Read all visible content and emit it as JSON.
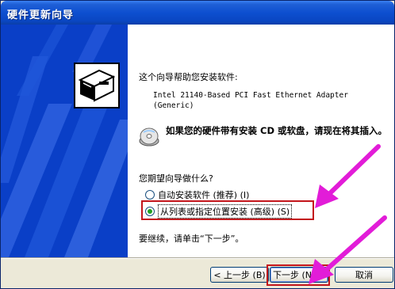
{
  "window": {
    "title": "硬件更新向导"
  },
  "wizard": {
    "intro": "这个向导帮助您安装软件:",
    "device_line1": "Intel 21140-Based PCI Fast Ethernet Adapter",
    "device_line2": "(Generic)",
    "cd_prompt": "如果您的硬件带有安装 CD 或软盘，请现在将其插入。",
    "question": "您期望向导做什么?",
    "options": [
      {
        "label": "自动安装软件 (推荐) (I)",
        "selected": false
      },
      {
        "label": "从列表或指定位置安装 (高级) (S)",
        "selected": true
      }
    ],
    "continue_hint": "要继续，请单击“下一步”。"
  },
  "buttons": {
    "back": "< 上一步 (B)",
    "next": "下一步 (N) >",
    "cancel": "取消"
  },
  "colors": {
    "titlebar": "#0a46c2",
    "left_panel": "#0a3fc7",
    "highlight": "#c3151b",
    "arrow": "#e21cd8"
  },
  "icons": [
    "hardware-wizard-icon",
    "cd-icon",
    "pointer-arrow"
  ]
}
